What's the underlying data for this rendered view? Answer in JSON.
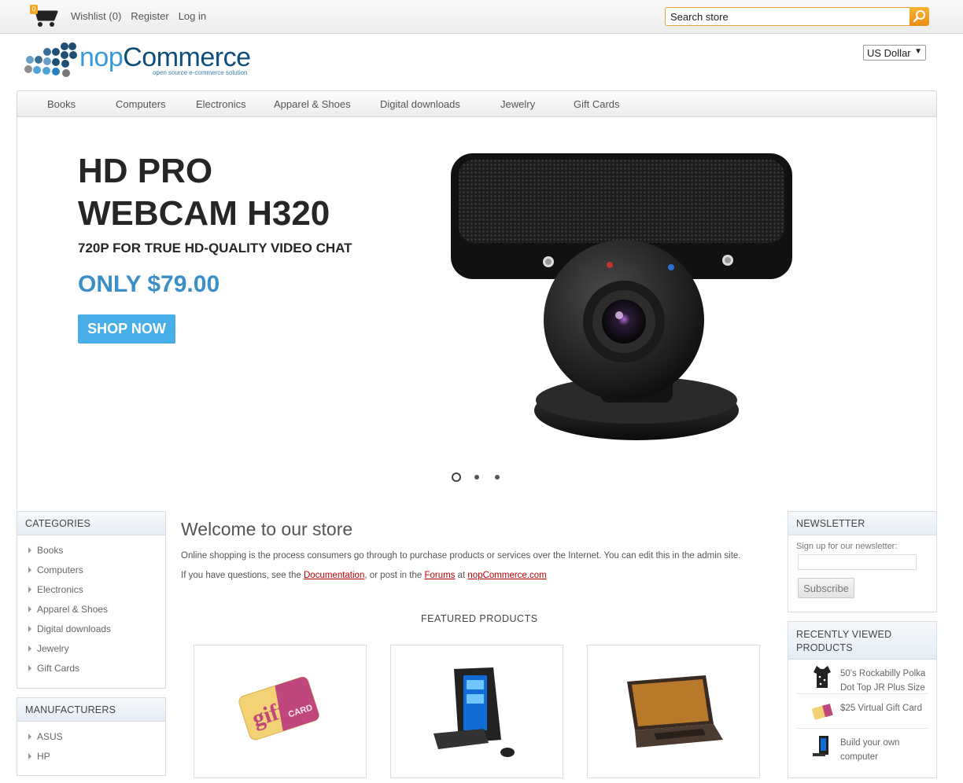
{
  "topbar": {
    "cart_count": "0",
    "wishlist": "Wishlist (0)",
    "register": "Register",
    "login": "Log in",
    "search_value": "Search store"
  },
  "header": {
    "logo_nop": "nop",
    "logo_commerce": "Commerce",
    "logo_tagline": "open source e-commerce solution",
    "currency": "US Dollar"
  },
  "menu": [
    "Books",
    "Computers",
    "Electronics",
    "Apparel & Shoes",
    "Digital downloads",
    "Jewelry",
    "Gift Cards"
  ],
  "slider": {
    "title_line1": "HD PRO",
    "title_line2": "WEBCAM H320",
    "subtitle": "720P FOR TRUE HD-QUALITY VIDEO CHAT",
    "price": "ONLY $79.00",
    "button": "SHOP NOW",
    "slide_count": 3,
    "active_slide": 1
  },
  "categories": {
    "title": "CATEGORIES",
    "items": [
      "Books",
      "Computers",
      "Electronics",
      "Apparel & Shoes",
      "Digital downloads",
      "Jewelry",
      "Gift Cards"
    ]
  },
  "manufacturers": {
    "title": "MANUFACTURERS",
    "items": [
      "ASUS",
      "HP"
    ]
  },
  "main": {
    "welcome": "Welcome to our store",
    "intro": "Online shopping is the process consumers go through to purchase products or services over the Internet. You can edit this in the admin site.",
    "help_prefix": "If you have questions, see the ",
    "help_doc": "Documentation",
    "help_mid": ", or post in the ",
    "help_forums": "Forums",
    "help_at": " at ",
    "help_site": "nopCommerce.com",
    "featured_title": "FEATURED PRODUCTS"
  },
  "newsletter": {
    "title": "NEWSLETTER",
    "label": "Sign up for our newsletter:",
    "button": "Subscribe"
  },
  "recently_viewed": {
    "title_line1": "RECENTLY VIEWED",
    "title_line2": "PRODUCTS",
    "items": [
      "50's Rockabilly Polka Dot Top JR Plus Size",
      "$25 Virtual Gift Card",
      "Build your own computer"
    ]
  },
  "colors": {
    "accent_blue": "#3a8fc8",
    "search_orange": "#ec8b12",
    "link_red": "#bb0000"
  }
}
